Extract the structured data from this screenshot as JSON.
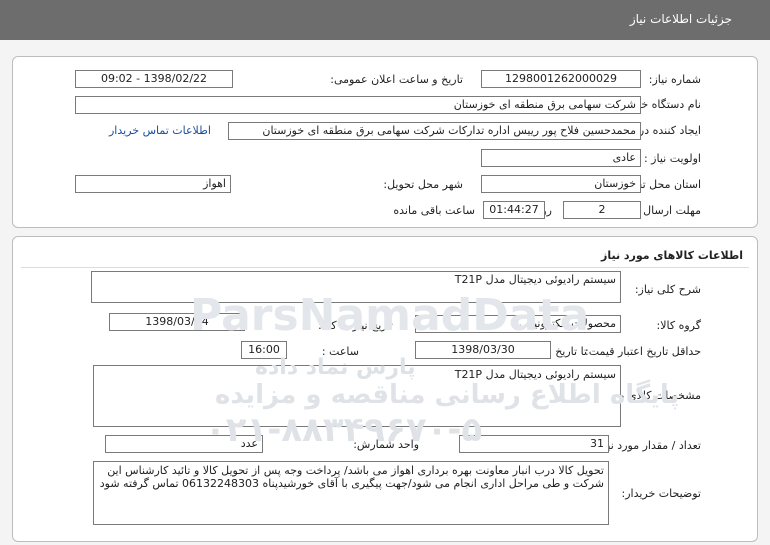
{
  "header": {
    "title": "جزئیات اطلاعات نیاز"
  },
  "need_info": {
    "need_number": {
      "label": "شماره نیاز:",
      "value": "1298001262000029"
    },
    "announce_datetime": {
      "label": "تاریخ و ساعت اعلان عمومی:",
      "value": "1398/02/22 - 09:02"
    },
    "buyer_org": {
      "label": "نام دستگاه خریدار:",
      "value": "شرکت سهامی برق منطقه ای خوزستان"
    },
    "requester": {
      "label": "ایجاد کننده درخواست:",
      "value": "محمدحسین فلاح پور رییس اداره تدارکات شرکت سهامی برق منطقه ای خوزستان"
    },
    "contact_link": "اطلاعات تماس خریدار",
    "priority": {
      "label": "اولویت نیاز :",
      "value": "عادی"
    },
    "delivery_province": {
      "label": "استان محل تحویل:",
      "value": "خوزستان"
    },
    "delivery_city": {
      "label": "شهر محل تحویل:",
      "value": "اهواز"
    },
    "deadline": {
      "label": "مهلت ارسال پاسخ:",
      "days": "2",
      "days_label": "روز و",
      "time": "01:44:27",
      "remaining_label": "ساعت باقی مانده"
    }
  },
  "goods": {
    "section_title": "اطلاعات کالاهای مورد نیاز",
    "general_desc": {
      "label": "شرح کلی نیاز:",
      "value": "سیستم رادیوئی دیجیتال مدل T21P"
    },
    "goods_group": {
      "label": "گروه کالا:",
      "value": "محصولات الکترونیکی"
    },
    "need_date": {
      "label": "تاریخ نیاز به کالا:",
      "value": "1398/03/04"
    },
    "price_validity": {
      "label": "حداقل تاریخ اعتبار قیمت:",
      "until_label": "تا تاریخ :",
      "date": "1398/03/30",
      "time_label": "ساعت :",
      "time": "16:00"
    },
    "specs": {
      "label": "مشخصات کالای مورد نیاز:",
      "value": "سیستم رادیوئی دیجیتال مدل T21P"
    },
    "quantity": {
      "label": "تعداد / مقدار مورد نیاز:",
      "value": "31"
    },
    "unit": {
      "label": "واحد شمارش:",
      "value": "عدد"
    },
    "buyer_notes": {
      "label": "توضیحات خریدار:",
      "value": "تحویل کالا درب انبار معاونت بهره برداری اهواز می باشد/ پرداخت وجه پس از تحویل کالا و تائید کارشناس این شرکت و طی مراحل اداری  انجام می شود/جهت پیگیری با آقای خورشیدپناه 06132248303 تماس گرفته شود"
    }
  },
  "watermark": {
    "brand": "ParsNamadData",
    "line1": "پایگاه اطلاع رسانی مناقصه و مزایده",
    "line2": "پارس نماد داده",
    "phone": "۰۲۱-۸۸۳۴۹۶۷۰-۵"
  }
}
